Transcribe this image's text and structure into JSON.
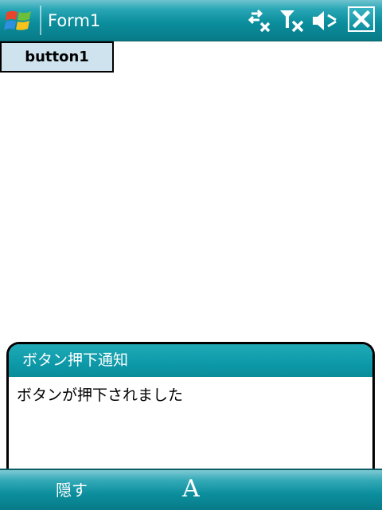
{
  "titlebar": {
    "title": "Form1",
    "icons": [
      "windows-start-icon",
      "connectivity-icon",
      "signal-off-icon",
      "volume-off-icon",
      "close-icon"
    ]
  },
  "form": {
    "button1_label": "button1"
  },
  "notification": {
    "title": "ボタン押下通知",
    "message": "ボタンが押下されました"
  },
  "softkeys": {
    "left_label": "隠す",
    "sip_label": "A",
    "right_label": ""
  },
  "colors": {
    "bar_teal": "#0b8e9d",
    "bar_highlight": "#6fc3cf",
    "button_face": "#cfe3ef",
    "background": "#ffffff"
  }
}
